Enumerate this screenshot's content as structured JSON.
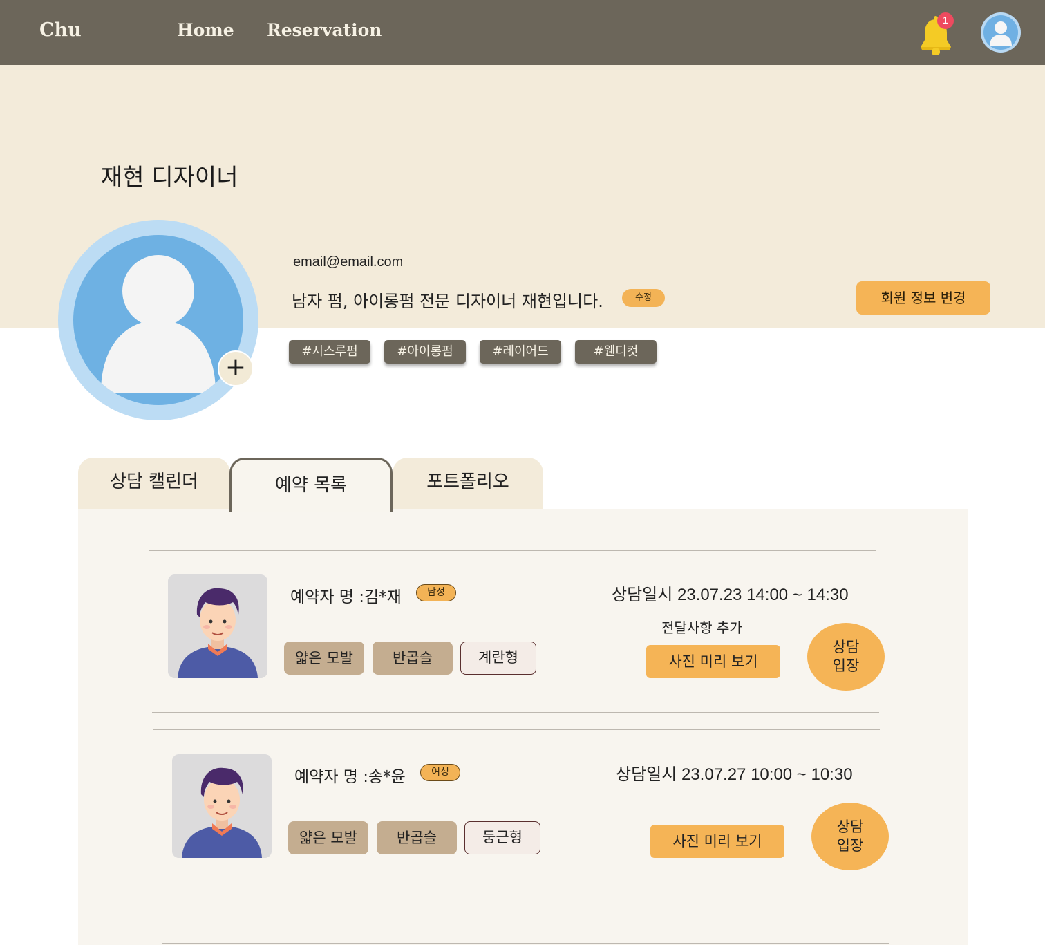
{
  "header": {
    "brand": "Chu",
    "nav": {
      "home": "Home",
      "reservation": "Reservation"
    },
    "notification_count": "1",
    "icons": {
      "bell": "bell-icon",
      "user": "user-avatar-icon"
    }
  },
  "profile": {
    "name": "재현 디자이너",
    "email": "email@email.com",
    "intro": "남자 펌, 아이롱펌 전문 디자이너 재현입니다.",
    "edit_label": "수정",
    "member_button": "회원 정보 변경",
    "add_photo_label": "+",
    "hashtags": [
      "#시스루펌",
      "#아이롱펌",
      "#레이어드",
      "#웬디컷"
    ]
  },
  "tabs": {
    "calendar": "상담 캘린더",
    "reservations": "예약 목록",
    "portfolio": "포트폴리오",
    "active": "reservations"
  },
  "reservations": [
    {
      "customer": "예약자 명 :김*재",
      "gender": "남성",
      "hair_type": "얇은 모발",
      "hair_shape": "반곱슬",
      "face_shape": "계란형",
      "schedule": "상담일시 23.07.23  14:00 ~ 14:30",
      "memo_label": "전달사항 추가",
      "photo_button": "사진 미리 보기",
      "enter_line1": "상담",
      "enter_line2": "입장"
    },
    {
      "customer": "예약자 명 :송*윤",
      "gender": "여성",
      "hair_type": "얇은 모발",
      "hair_shape": "반곱슬",
      "face_shape": "둥근형",
      "schedule": "상담일시 23.07.27  10:00 ~ 10:30",
      "photo_button": "사진 미리 보기",
      "enter_line1": "상담",
      "enter_line2": "입장"
    }
  ],
  "colors": {
    "header_bg": "#6c665a",
    "hero_bg": "#f3ebda",
    "accent": "#f5b456",
    "hashtag_bg": "#6c665a",
    "style_chip_bg": "#c4ad90",
    "panel_bg": "#f8f5ef",
    "badge": "#ee4a5f"
  }
}
